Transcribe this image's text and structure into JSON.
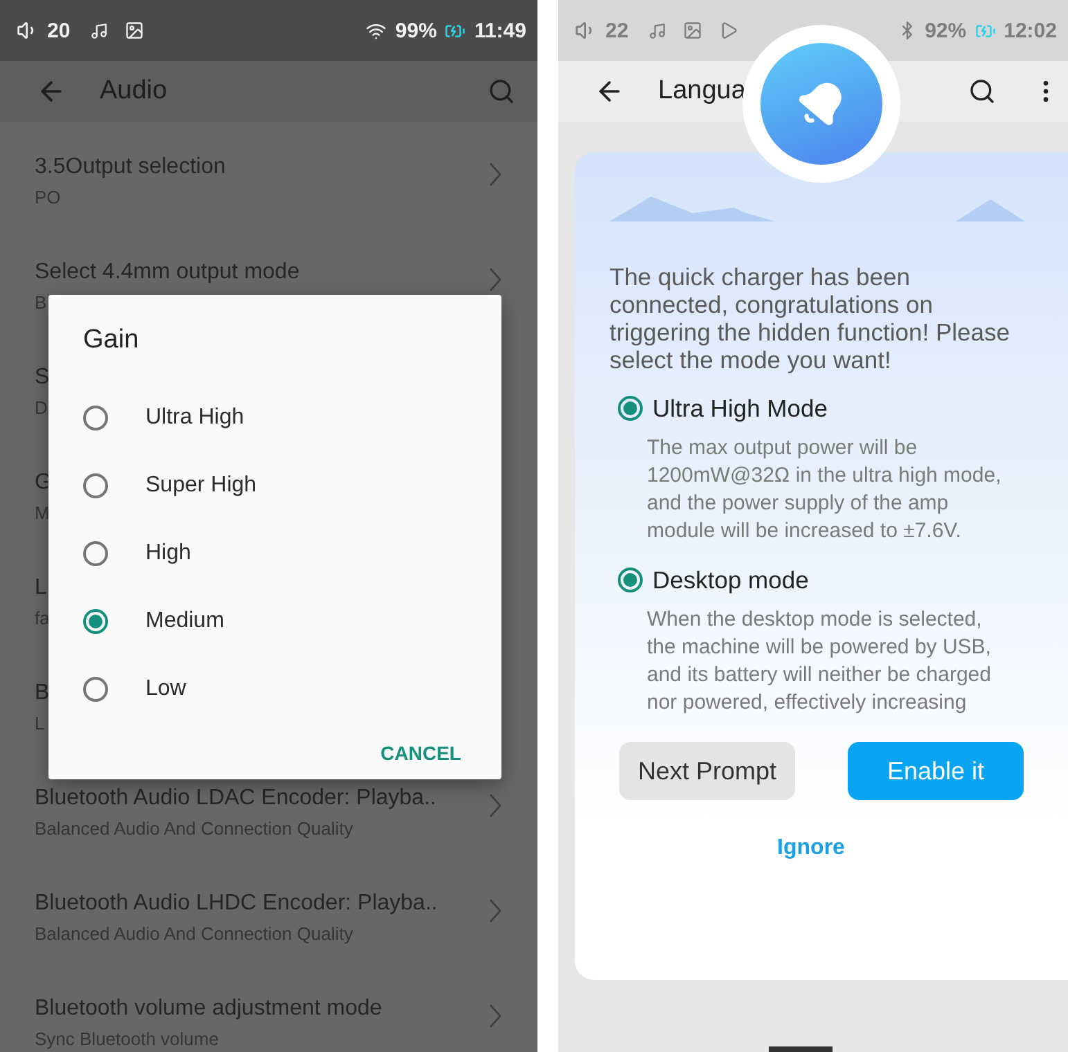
{
  "left_screen": {
    "status_bar": {
      "volume": "20",
      "battery": "99%",
      "time": "11:49"
    },
    "app_bar": {
      "title": "Audio"
    },
    "settings": [
      {
        "title": "3.5Output selection",
        "subtitle": "PO",
        "chevron": true
      },
      {
        "title": "Select 4.4mm output mode",
        "subtitle": "B",
        "chevron": true
      },
      {
        "title": "S",
        "subtitle": "D"
      },
      {
        "title": "G",
        "subtitle": "M"
      },
      {
        "title": "L",
        "subtitle": "fa"
      },
      {
        "title": "B",
        "subtitle": "L"
      },
      {
        "title": "Bluetooth Audio LDAC Encoder: Playba..",
        "subtitle": "Balanced Audio And Connection Quality",
        "chevron": true
      },
      {
        "title": "Bluetooth Audio LHDC Encoder: Playba..",
        "subtitle": "Balanced Audio And Connection Quality",
        "chevron": true
      },
      {
        "title": "Bluetooth volume adjustment mode",
        "subtitle": "Sync Bluetooth volume",
        "chevron": true
      }
    ],
    "gain_dialog": {
      "title": "Gain",
      "options": [
        {
          "label": "Ultra High",
          "selected": false
        },
        {
          "label": "Super High",
          "selected": false
        },
        {
          "label": "High",
          "selected": false
        },
        {
          "label": "Medium",
          "selected": true
        },
        {
          "label": "Low",
          "selected": false
        }
      ],
      "cancel": "CANCEL"
    }
  },
  "right_screen": {
    "status_bar": {
      "volume": "22",
      "battery": "92%",
      "time": "12:02"
    },
    "app_bar": {
      "title": "Langua"
    },
    "charger_dialog": {
      "message": "The quick charger has been connected, congratulations on triggering the hidden function! Please select the mode you want!",
      "modes": [
        {
          "title": "Ultra High Mode",
          "description": "The max output power will be 1200mW@32Ω in the ultra high mode, and the power supply of the amp module will be increased to ±7.6V.",
          "selected": true
        },
        {
          "title": "Desktop mode",
          "description": "When the desktop mode is selected, the machine will be powered by USB, and its battery will neither be charged nor powered, effectively increasing",
          "selected": true
        }
      ],
      "buttons": [
        {
          "label": "Next Prompt",
          "kind": "secondary"
        },
        {
          "label": "Enable it",
          "kind": "primary"
        }
      ],
      "ignore": "Ignore"
    }
  }
}
